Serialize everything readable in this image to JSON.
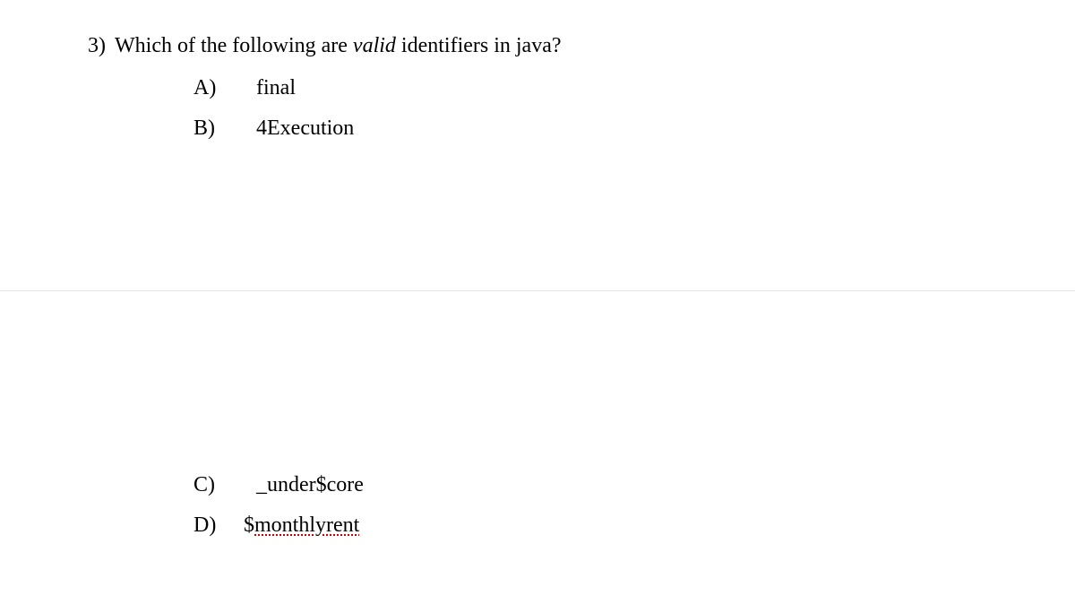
{
  "question": {
    "number": "3)",
    "text_before_italic": "Which of the following are ",
    "italic_word": "valid",
    "text_after_italic": " identifiers in java?"
  },
  "options": {
    "a": {
      "label": "A)",
      "text": "final"
    },
    "b": {
      "label": "B)",
      "text": "4Execution"
    },
    "c": {
      "label": "C)",
      "text": "_under$core"
    },
    "d": {
      "label": "D)",
      "prefix": "$",
      "spellcheck_text": "monthlyrent"
    }
  }
}
